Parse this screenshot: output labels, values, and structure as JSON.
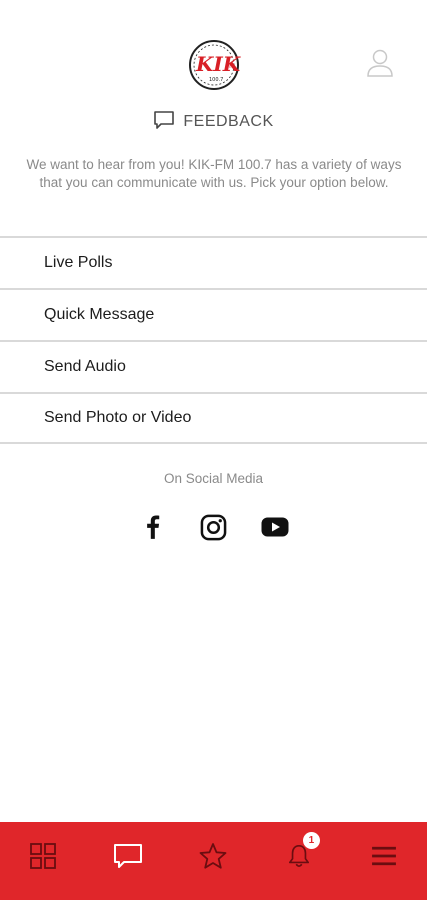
{
  "header": {
    "logo_icon": "kik-fm-logo",
    "profile_icon": "user-icon"
  },
  "page": {
    "title": "FEEDBACK",
    "title_icon": "message-icon",
    "intro": "We want to hear from you! KIK-FM 100.7 has a variety of ways that you can communicate with us. Pick your option below."
  },
  "menu": {
    "items": [
      {
        "label": "Live Polls"
      },
      {
        "label": "Quick Message"
      },
      {
        "label": "Send Audio"
      },
      {
        "label": "Send Photo or Video"
      }
    ]
  },
  "social": {
    "title": "On Social Media",
    "icons": [
      "facebook-icon",
      "instagram-icon",
      "youtube-icon"
    ]
  },
  "tabbar": {
    "color": "#e0262a",
    "tabs": [
      {
        "icon": "grid-icon"
      },
      {
        "icon": "message-icon"
      },
      {
        "icon": "star-icon"
      },
      {
        "icon": "bell-icon",
        "badge": "1"
      },
      {
        "icon": "menu-icon"
      }
    ]
  }
}
